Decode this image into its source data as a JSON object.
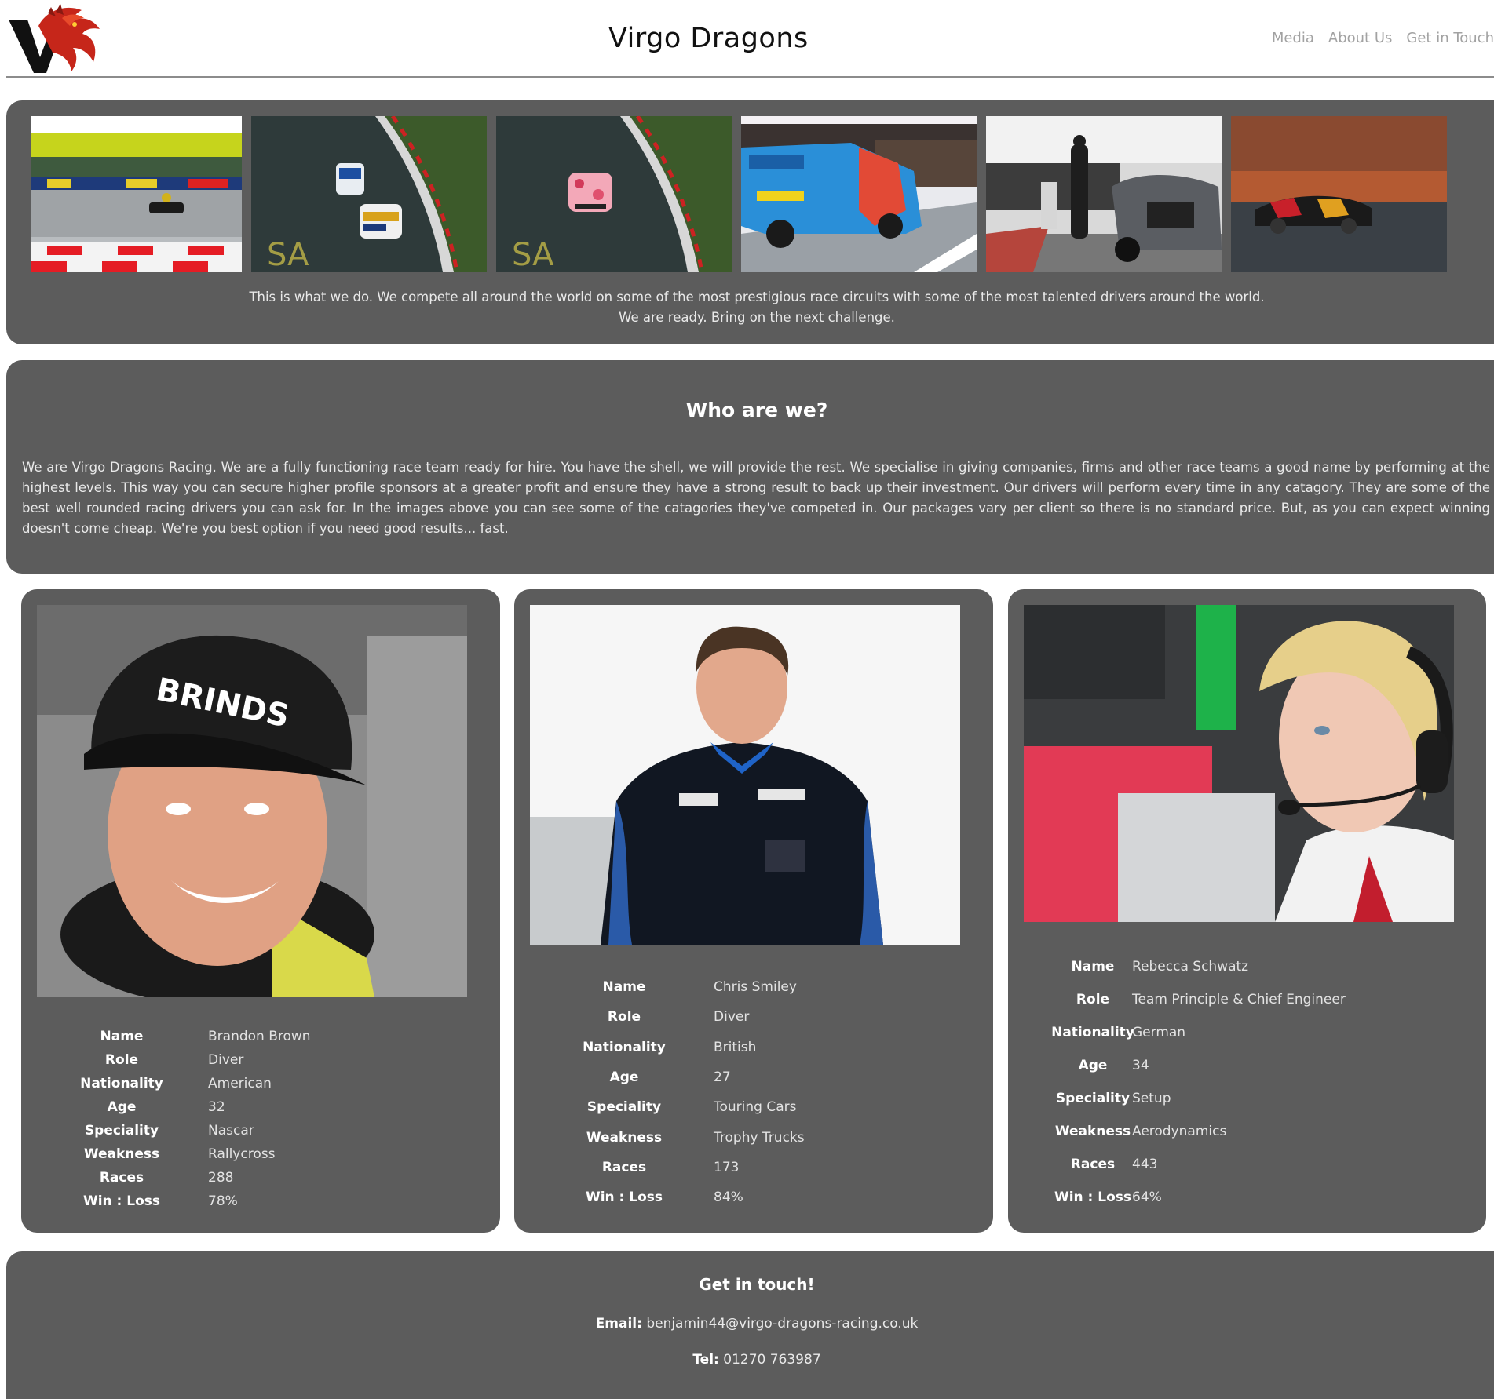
{
  "header": {
    "title": "Virgo Dragons",
    "nav": [
      "Media",
      "About Us",
      "Get in Touch"
    ]
  },
  "gallery": {
    "line1": "This is what we do. We compete all around the world on some of the most prestigious race circuits with some of the most talented drivers around the world.",
    "line2": "We are ready. Bring on the next challenge."
  },
  "about": {
    "heading": "Who are we?",
    "body": "We are Virgo Dragons Racing. We are a fully functioning race team ready for hire. You have the shell, we will provide the rest. We specialise in giving companies, firms and other race teams a good name by performing at the highest levels. This way you can secure higher profile sponsors at a greater profit and ensure they have a strong result to back up their investment. Our drivers will perform every time in any catagory. They are some of the best well rounded racing drivers you can ask for. In the images above you can see some of the catagories they've competed in. Our packages vary per client so there is no standard price. But, as you can expect winning doesn't come cheap. We're you best option if you need good results... fast."
  },
  "stat_labels": [
    "Name",
    "Role",
    "Nationality",
    "Age",
    "Speciality",
    "Weakness",
    "Races",
    "Win : Loss"
  ],
  "team": [
    {
      "Name": "Brandon Brown",
      "Role": "Diver",
      "Nationality": "American",
      "Age": "32",
      "Speciality": "Nascar",
      "Weakness": "Rallycross",
      "Races": "288",
      "Win : Loss": "78%"
    },
    {
      "Name": "Chris Smiley",
      "Role": "Diver",
      "Nationality": "British",
      "Age": "27",
      "Speciality": "Touring Cars",
      "Weakness": "Trophy Trucks",
      "Races": "173",
      "Win : Loss": "84%"
    },
    {
      "Name": "Rebecca Schwatz",
      "Role": "Team Principle & Chief Engineer",
      "Nationality": "German",
      "Age": "34",
      "Speciality": "Setup",
      "Weakness": "Aerodynamics",
      "Races": "443",
      "Win : Loss": "64%"
    }
  ],
  "contact": {
    "heading": "Get in touch!",
    "email_label": "Email:",
    "email": "benjamin44@virgo-dragons-racing.co.uk",
    "tel_label": "Tel:",
    "tel": "01270 763987"
  },
  "icons": {
    "logo": "dragon-logo-icon"
  },
  "colors": {
    "panel": "#5c5c5c",
    "page": "#ffffff",
    "accent": "#d32a1e"
  }
}
